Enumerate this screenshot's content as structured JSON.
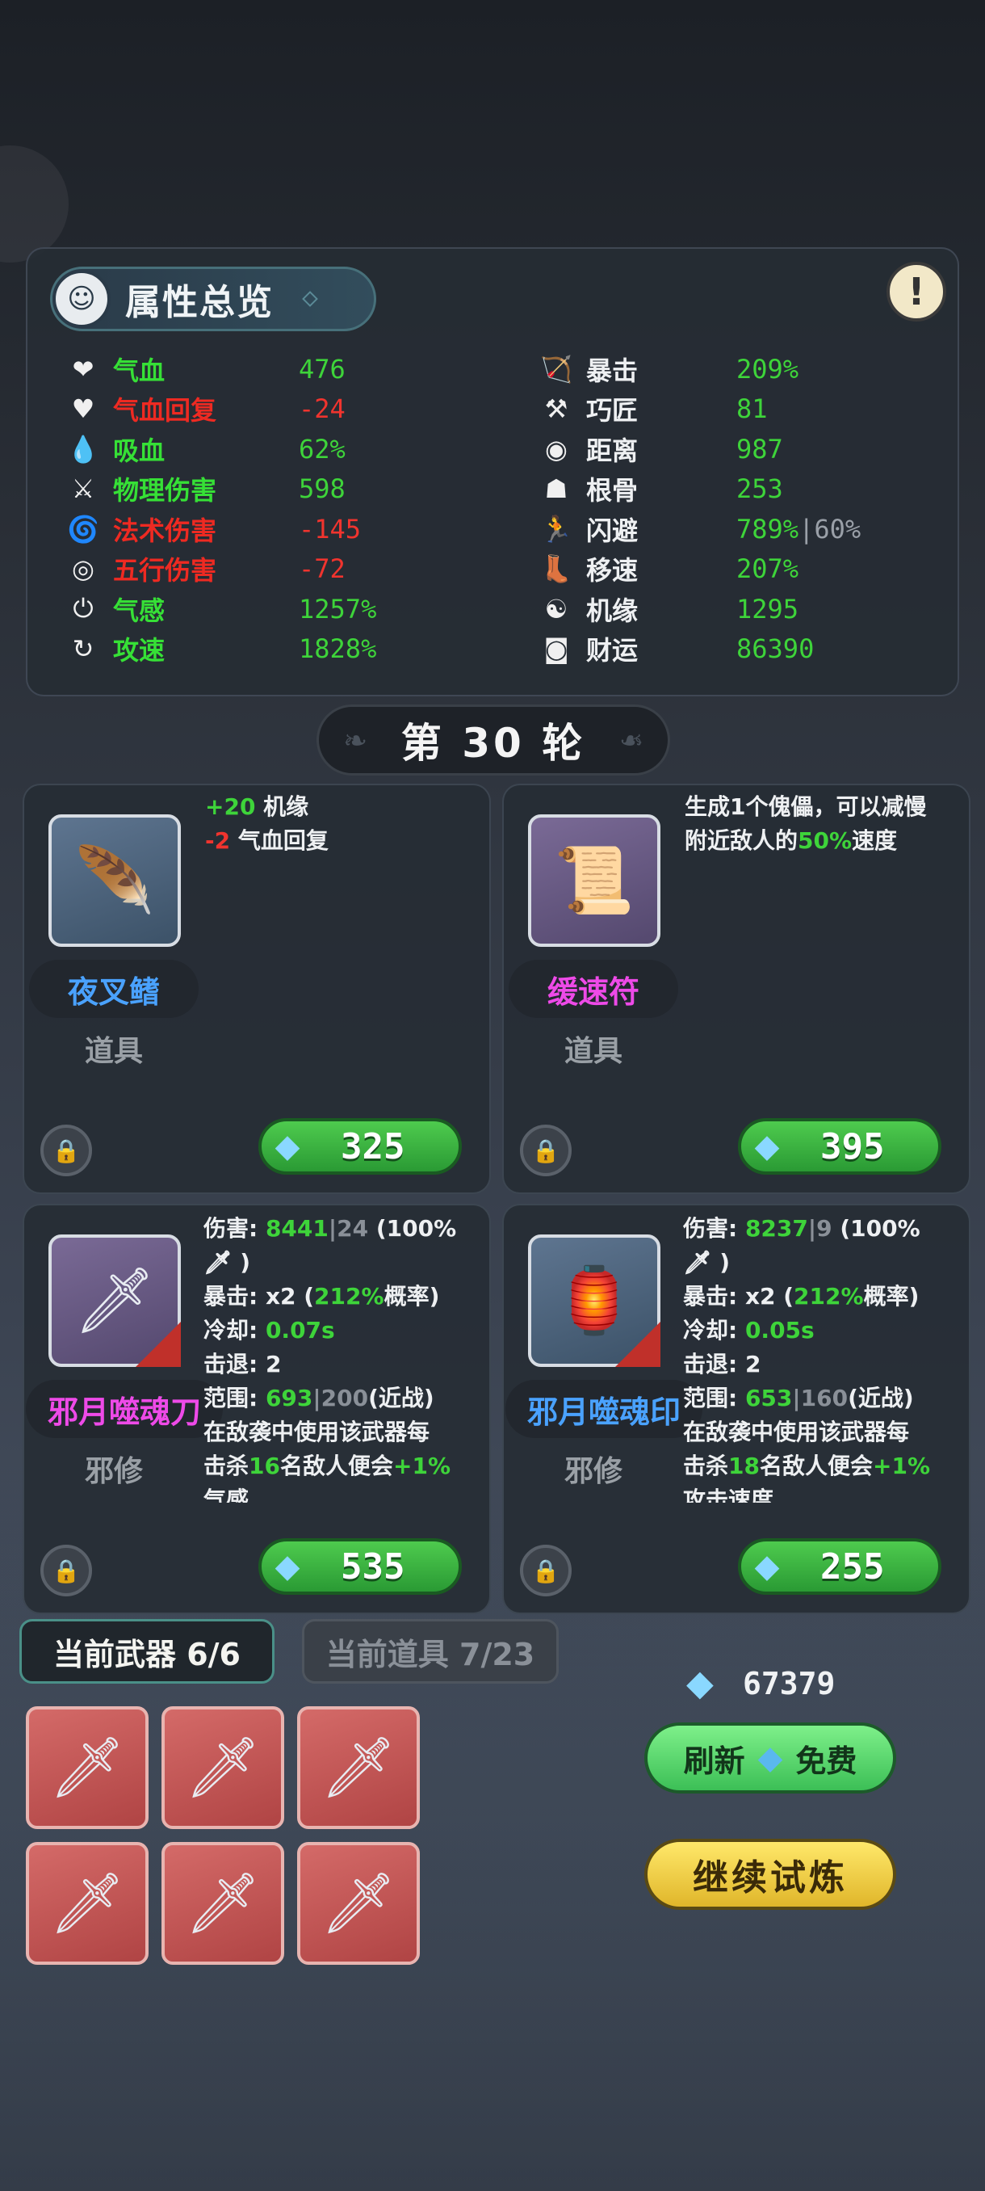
{
  "stats": {
    "title": "属性总览",
    "info_icon": "!",
    "left": [
      {
        "icon": "❤",
        "label": "气血",
        "value": "476",
        "label_color": "g",
        "value_color": "g"
      },
      {
        "icon": "♥",
        "label": "气血回复",
        "value": "-24",
        "label_color": "r",
        "value_color": "r"
      },
      {
        "icon": "💧",
        "label": "吸血",
        "value": "62%",
        "label_color": "g",
        "value_color": "g"
      },
      {
        "icon": "⚔",
        "label": "物理伤害",
        "value": "598",
        "label_color": "g",
        "value_color": "g"
      },
      {
        "icon": "🌀",
        "label": "法术伤害",
        "value": "-145",
        "label_color": "r",
        "value_color": "r"
      },
      {
        "icon": "◎",
        "label": "五行伤害",
        "value": "-72",
        "label_color": "r",
        "value_color": "r"
      },
      {
        "icon": "⏻",
        "label": "气感",
        "value": "1257%",
        "label_color": "g",
        "value_color": "g"
      },
      {
        "icon": "↻",
        "label": "攻速",
        "value": "1828%",
        "label_color": "g",
        "value_color": "g"
      }
    ],
    "right": [
      {
        "icon": "🏹",
        "label": "暴击",
        "value": "209%",
        "value_color": "g"
      },
      {
        "icon": "⚒",
        "label": "巧匠",
        "value": "81",
        "value_color": "g"
      },
      {
        "icon": "◉",
        "label": "距离",
        "value": "987",
        "value_color": "g"
      },
      {
        "icon": "☗",
        "label": "根骨",
        "value": "253",
        "value_color": "g"
      },
      {
        "icon": "🏃",
        "label": "闪避",
        "value": "789%",
        "value_extra": "|60%",
        "value_color": "g"
      },
      {
        "icon": "👢",
        "label": "移速",
        "value": "207%",
        "value_color": "g"
      },
      {
        "icon": "☯",
        "label": "机缘",
        "value": "1295",
        "value_color": "g"
      },
      {
        "icon": "◙",
        "label": "财运",
        "value": "86390",
        "value_color": "g"
      }
    ]
  },
  "round": {
    "label": "第 30 轮"
  },
  "cards": [
    {
      "name": "夜叉鳍",
      "type": "道具",
      "price": "325",
      "desc_lines": [
        [
          {
            "t": "+20",
            "c": "g"
          },
          {
            "t": " 机缘",
            "c": "w"
          }
        ],
        [
          {
            "t": "-2",
            "c": "r"
          },
          {
            "t": " 气血回复",
            "c": "w"
          }
        ]
      ]
    },
    {
      "name": "缓速符",
      "type": "道具",
      "price": "395",
      "desc_lines": [
        [
          {
            "t": "生成1个傀儡，可以减慢",
            "c": "w"
          }
        ],
        [
          {
            "t": "附近敌人的",
            "c": "w"
          },
          {
            "t": "50%",
            "c": "g"
          },
          {
            "t": "速度",
            "c": "w"
          }
        ]
      ]
    },
    {
      "name": "邪月噬魂刀",
      "type": "邪修",
      "price": "535",
      "desc_lines": [
        [
          {
            "t": "伤害: ",
            "c": "w"
          },
          {
            "t": "8441",
            "c": "g"
          },
          {
            "t": "|24",
            "c": "gray"
          },
          {
            "t": " (100%",
            "c": "w"
          }
        ],
        [
          {
            "t": "🗡 )",
            "c": "w"
          }
        ],
        [
          {
            "t": "暴击: x2 (",
            "c": "w"
          },
          {
            "t": "212%",
            "c": "g"
          },
          {
            "t": "概率)",
            "c": "w"
          }
        ],
        [
          {
            "t": "冷却: ",
            "c": "w"
          },
          {
            "t": "0.07s",
            "c": "g"
          }
        ],
        [
          {
            "t": "击退: 2",
            "c": "w"
          }
        ],
        [
          {
            "t": "范围: ",
            "c": "w"
          },
          {
            "t": "693",
            "c": "g"
          },
          {
            "t": "|200",
            "c": "gray"
          },
          {
            "t": "(近战)",
            "c": "w"
          }
        ],
        [
          {
            "t": "在敌袭中使用该武器每",
            "c": "w"
          }
        ],
        [
          {
            "t": "击杀",
            "c": "w"
          },
          {
            "t": "16",
            "c": "g"
          },
          {
            "t": "名敌人便会",
            "c": "w"
          },
          {
            "t": "+1%",
            "c": "g"
          }
        ],
        [
          {
            "t": "气感",
            "c": "w"
          }
        ]
      ]
    },
    {
      "name": "邪月噬魂印",
      "type": "邪修",
      "price": "255",
      "desc_lines": [
        [
          {
            "t": "伤害: ",
            "c": "w"
          },
          {
            "t": "8237",
            "c": "g"
          },
          {
            "t": "|9",
            "c": "gray"
          },
          {
            "t": " (100%",
            "c": "w"
          }
        ],
        [
          {
            "t": "🗡 )",
            "c": "w"
          }
        ],
        [
          {
            "t": "暴击: x2 (",
            "c": "w"
          },
          {
            "t": "212%",
            "c": "g"
          },
          {
            "t": "概率)",
            "c": "w"
          }
        ],
        [
          {
            "t": "冷却: ",
            "c": "w"
          },
          {
            "t": "0.05s",
            "c": "g"
          }
        ],
        [
          {
            "t": "击退: 2",
            "c": "w"
          }
        ],
        [
          {
            "t": "范围: ",
            "c": "w"
          },
          {
            "t": "653",
            "c": "g"
          },
          {
            "t": "|160",
            "c": "gray"
          },
          {
            "t": "(近战)",
            "c": "w"
          }
        ],
        [
          {
            "t": "在敌袭中使用该武器每",
            "c": "w"
          }
        ],
        [
          {
            "t": "击杀",
            "c": "w"
          },
          {
            "t": "18",
            "c": "g"
          },
          {
            "t": "名敌人便会",
            "c": "w"
          },
          {
            "t": "+1%",
            "c": "g"
          }
        ],
        [
          {
            "t": "攻击速度",
            "c": "w"
          }
        ]
      ]
    }
  ],
  "tabs": {
    "weapons": "当前武器 6/6",
    "items": "当前道具 7/23"
  },
  "currency": {
    "amount": "67379",
    "icon": "crystal-gem-icon"
  },
  "buttons": {
    "refresh": "刷新",
    "free": "免费",
    "continue": "继续试炼"
  }
}
